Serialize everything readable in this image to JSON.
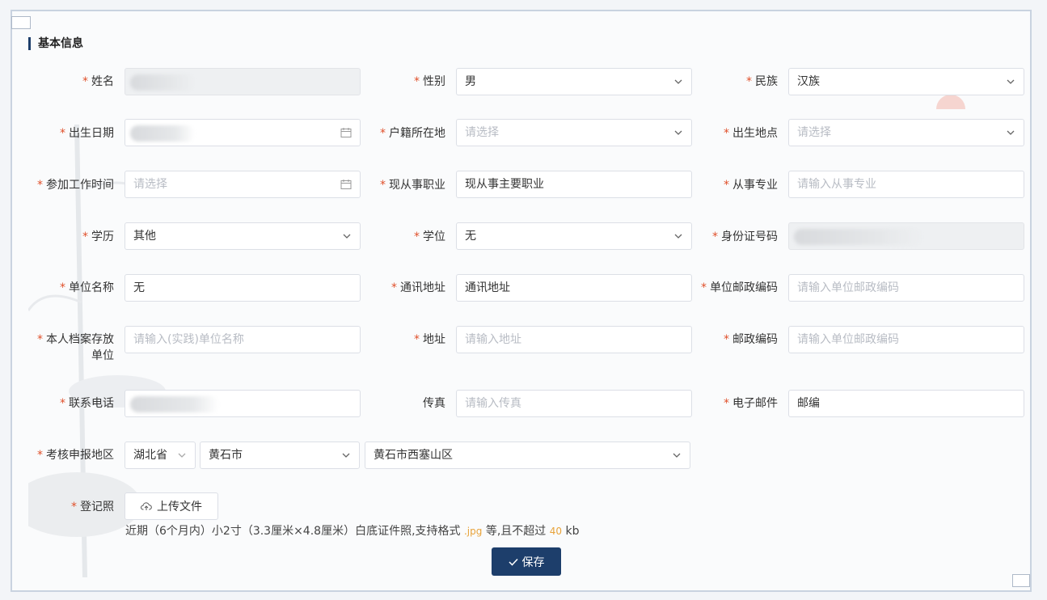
{
  "section_title": "基本信息",
  "labels": {
    "name": "姓名",
    "gender": "性别",
    "ethnicity": "民族",
    "birth_date": "出生日期",
    "household": "户籍所在地",
    "birth_place": "出生地点",
    "work_start": "参加工作时间",
    "occupation": "现从事职业",
    "specialty": "从事专业",
    "education": "学历",
    "degree": "学位",
    "id_number": "身份证号码",
    "unit_name": "单位名称",
    "address": "通讯地址",
    "unit_postcode": "单位邮政编码",
    "archive_unit_1": "本人档案存放",
    "archive_unit_2": "单位",
    "archive_address": "地址",
    "postcode": "邮政编码",
    "phone": "联系电话",
    "fax": "传真",
    "email": "电子邮件",
    "region": "考核申报地区",
    "photo": "登记照"
  },
  "values": {
    "gender": "男",
    "ethnicity": "汉族",
    "occupation": "现从事主要职业",
    "education": "其他",
    "degree": "无",
    "unit_name": "无",
    "address": "通讯地址",
    "email": "邮编",
    "province": "湖北省",
    "city": "黄石市",
    "district": "黄石市西塞山区"
  },
  "placeholders": {
    "household": "请选择",
    "birth_place": "请选择",
    "work_start": "请选择",
    "specialty": "请输入从事专业",
    "unit_postcode": "请输入单位邮政编码",
    "archive_unit": "请输入(实践)单位名称",
    "archive_address": "请输入地址",
    "postcode": "请输入单位邮政编码",
    "fax": "请输入传真"
  },
  "upload": {
    "label": "上传文件",
    "icon": "cloud-upload-icon"
  },
  "hint": {
    "prefix": "近期（6个月内）小2寸（3.3厘米×4.8厘米）白底证件照,支持格式",
    "format": ".jpg",
    "mid": "等,且不超过",
    "size": "40",
    "unit": "kb"
  },
  "save_label": "保存",
  "colors": {
    "primary": "#1d3e6b",
    "required": "#e0502a",
    "accent": "#e8a33a"
  }
}
